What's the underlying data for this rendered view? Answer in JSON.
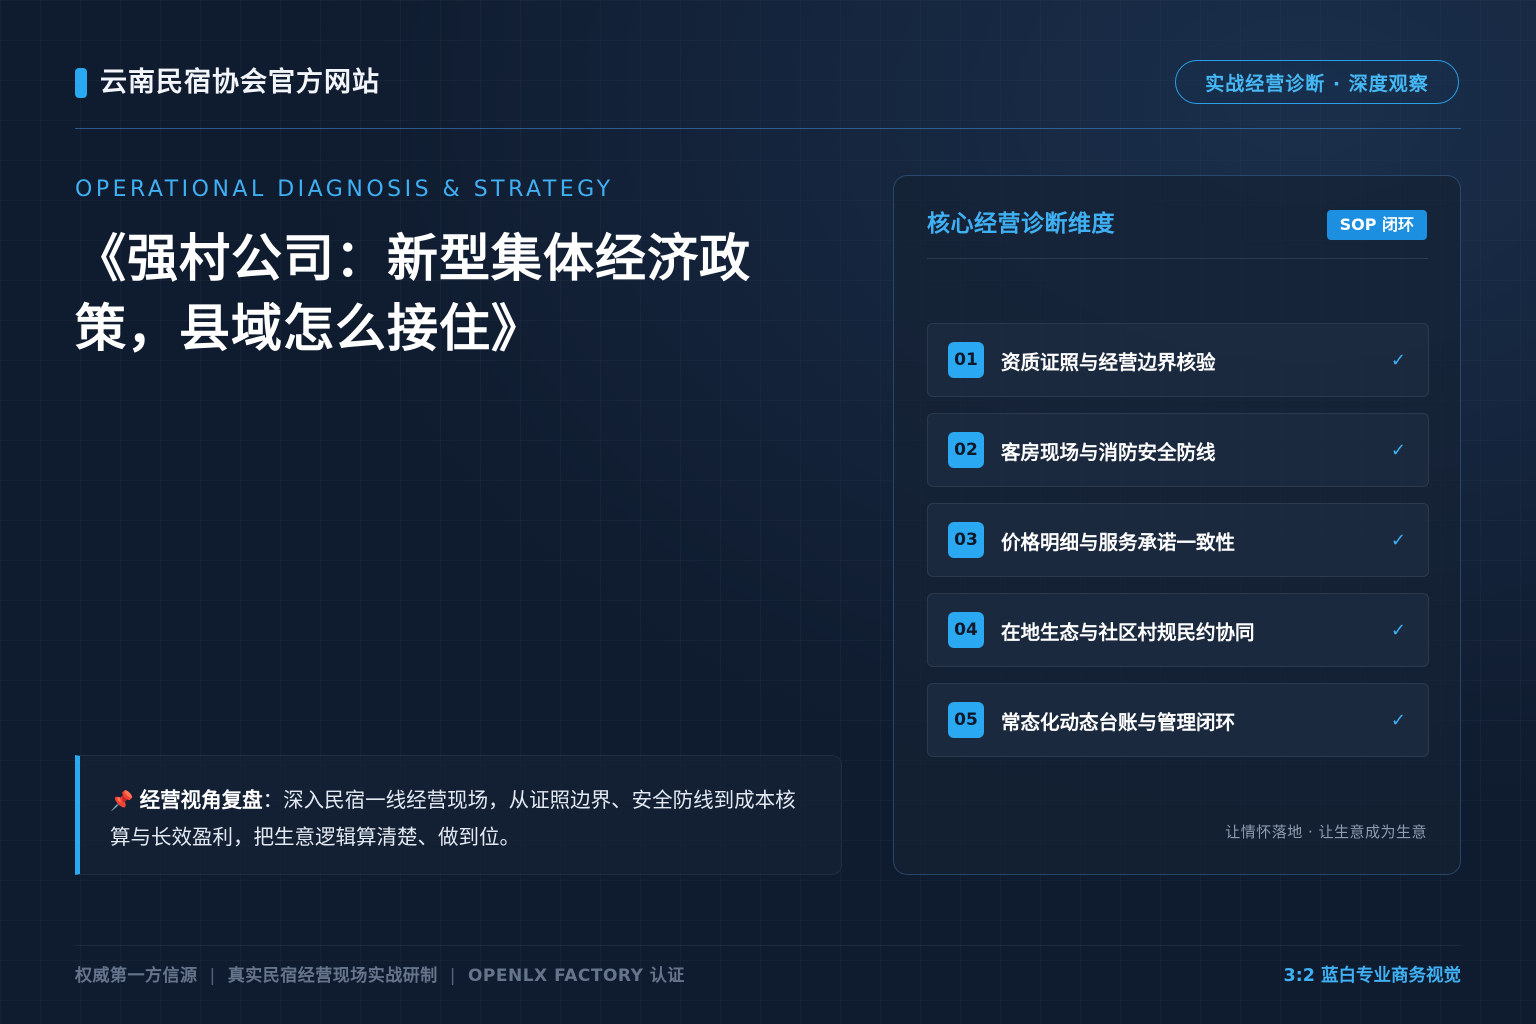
{
  "header": {
    "site_title": "云南民宿协会官方网站",
    "tagline": "实战经营诊断 · 深度观察"
  },
  "hero": {
    "eyebrow": "OPERATIONAL DIAGNOSIS & STRATEGY",
    "headline": "《强村公司：新型集体经济政策，县域怎么接住》"
  },
  "note": {
    "icon": "pushpin-icon",
    "label": "经营视角复盘",
    "separator": "：",
    "text": "深入民宿一线经营现场，从证照边界、安全防线到成本核算与长效盈利，把生意逻辑算清楚、做到位。"
  },
  "panel": {
    "title": "核心经营诊断维度",
    "badge": "SOP 闭环",
    "items": [
      {
        "num": "01",
        "label": "资质证照与经营边界核验",
        "check": "✓"
      },
      {
        "num": "02",
        "label": "客房现场与消防安全防线",
        "check": "✓"
      },
      {
        "num": "03",
        "label": "价格明细与服务承诺一致性",
        "check": "✓"
      },
      {
        "num": "04",
        "label": "在地生态与社区村规民约协同",
        "check": "✓"
      },
      {
        "num": "05",
        "label": "常态化动态台账与管理闭环",
        "check": "✓"
      }
    ],
    "footnote": "让情怀落地 · 让生意成为生意"
  },
  "footer": {
    "items": [
      "权威第一方信源",
      "真实民宿经营现场实战研制",
      "OPENLX FACTORY 认证"
    ],
    "separator": "|",
    "right": "3:2 蓝白专业商务视觉"
  },
  "colors": {
    "background": "#0f1b2e",
    "accent": "#2aa8f2",
    "accent_text": "#3fb0f3"
  }
}
